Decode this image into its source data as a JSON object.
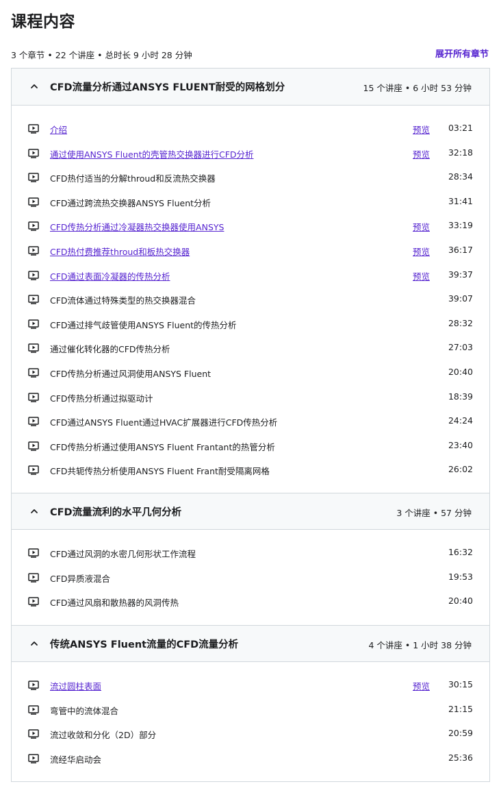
{
  "page": {
    "title": "课程内容",
    "summary": "3 个章节 • 22 个讲座 • 总时长 9 小时 28 分钟",
    "expand_all": "展开所有章节"
  },
  "sections": [
    {
      "title": "CFD流量分析通过ANSYS FLUENT耐受的网格划分",
      "meta": "15 个讲座 • 6 小时 53 分钟",
      "lectures": [
        {
          "title": "介绍",
          "preview": "预览",
          "duration": "03:21"
        },
        {
          "title": "通过使用ANSYS Fluent的壳管热交换器进行CFD分析",
          "preview": "预览",
          "duration": "32:18"
        },
        {
          "title": "CFD热付适当的分解throud和反流热交换器",
          "preview": "",
          "duration": "28:34"
        },
        {
          "title": "CFD通过跨流热交换器ANSYS Fluent分析",
          "preview": "",
          "duration": "31:41"
        },
        {
          "title": "CFD传热分析通过冷凝器热交换器使用ANSYS",
          "preview": "预览",
          "duration": "33:19"
        },
        {
          "title": "CFD热付费推荐throud和板热交换器",
          "preview": "预览",
          "duration": "36:17"
        },
        {
          "title": "CFD通过表面冷凝器的传热分析",
          "preview": "预览",
          "duration": "39:37"
        },
        {
          "title": "CFD流体通过特殊类型的热交换器混合",
          "preview": "",
          "duration": "39:07"
        },
        {
          "title": "CFD通过排气歧管使用ANSYS Fluent的传热分析",
          "preview": "",
          "duration": "28:32"
        },
        {
          "title": "通过催化转化器的CFD传热分析",
          "preview": "",
          "duration": "27:03"
        },
        {
          "title": "CFD传热分析通过风洞使用ANSYS Fluent",
          "preview": "",
          "duration": "20:40"
        },
        {
          "title": "CFD传热分析通过拟驱动计",
          "preview": "",
          "duration": "18:39"
        },
        {
          "title": "CFD通过ANSYS Fluent通过HVAC扩展器进行CFD传热分析",
          "preview": "",
          "duration": "24:24"
        },
        {
          "title": "CFD传热分析通过使用ANSYS Fluent Frantant的热管分析",
          "preview": "",
          "duration": "23:40"
        },
        {
          "title": "CFD共轭传热分析使用ANSYS Fluent Frant耐受隔离网格",
          "preview": "",
          "duration": "26:02"
        }
      ]
    },
    {
      "title": "CFD流量流利的水平几何分析",
      "meta": "3 个讲座 • 57 分钟",
      "lectures": [
        {
          "title": "CFD通过风洞的水密几何形状工作流程",
          "preview": "",
          "duration": "16:32"
        },
        {
          "title": "CFD异质液混合",
          "preview": "",
          "duration": "19:53"
        },
        {
          "title": "CFD通过风扇和散热器的风洞传热",
          "preview": "",
          "duration": "20:40"
        }
      ]
    },
    {
      "title": "传统ANSYS Fluent流量的CFD流量分析",
      "meta": "4 个讲座 • 1 小时 38 分钟",
      "lectures": [
        {
          "title": "流过圆柱表面",
          "preview": "预览",
          "duration": "30:15"
        },
        {
          "title": "弯管中的流体混合",
          "preview": "",
          "duration": "21:15"
        },
        {
          "title": "流过收敛和分化（2D）部分",
          "preview": "",
          "duration": "20:59"
        },
        {
          "title": "流经华启动会",
          "preview": "",
          "duration": "25:36"
        }
      ]
    }
  ],
  "icons": {
    "section_toggle": "chevron-up-icon",
    "lecture": "video-play-icon"
  },
  "colors": {
    "link": "#5624d0",
    "text": "#1c1d1f",
    "header_bg": "#f7f9fa",
    "border": "#d1d7dc"
  }
}
